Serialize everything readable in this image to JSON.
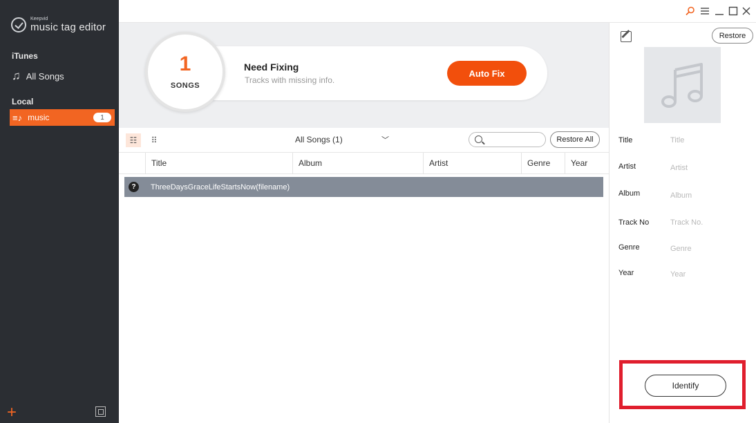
{
  "app": {
    "logo_small": "Keepvid",
    "logo_big": "music tag editor"
  },
  "sidebar": {
    "itunes_label": "iTunes",
    "all_songs": "All Songs",
    "local_label": "Local",
    "local_item": "music",
    "local_count": "1"
  },
  "titlebar": {
    "search_icon": "magnifier-icon",
    "menu_icon": "hamburger-icon",
    "minimize_icon": "minimize-icon",
    "maximize_icon": "maximize-icon",
    "close_icon": "close-icon"
  },
  "banner": {
    "count": "1",
    "count_unit": "SONGS",
    "heading": "Need Fixing",
    "subtext": "Tracks with missing info.",
    "autofix_label": "Auto Fix"
  },
  "toolbar": {
    "filter_label": "All Songs (1)",
    "search_value": "",
    "restore_all_label": "Restore All"
  },
  "table": {
    "columns": [
      "Title",
      "Album",
      "Artist",
      "Genre",
      "Year"
    ],
    "rows": [
      {
        "status": "?",
        "title": "ThreeDaysGraceLifeStartsNow(filename)"
      }
    ]
  },
  "details": {
    "restore_label": "Restore",
    "fields": [
      {
        "label": "Title",
        "placeholder": "Title"
      },
      {
        "label": "Artist",
        "placeholder": "Artist"
      },
      {
        "label": "Album",
        "placeholder": "Album"
      },
      {
        "label": "Track No",
        "placeholder": "Track No."
      },
      {
        "label": "Genre",
        "placeholder": "Genre"
      },
      {
        "label": "Year",
        "placeholder": "Year"
      }
    ],
    "identify_label": "Identify"
  },
  "colors": {
    "accent": "#f26522",
    "sidebar_bg": "#2b2e33",
    "highlight_frame": "#e01e2d",
    "row_selected": "#848c98"
  }
}
